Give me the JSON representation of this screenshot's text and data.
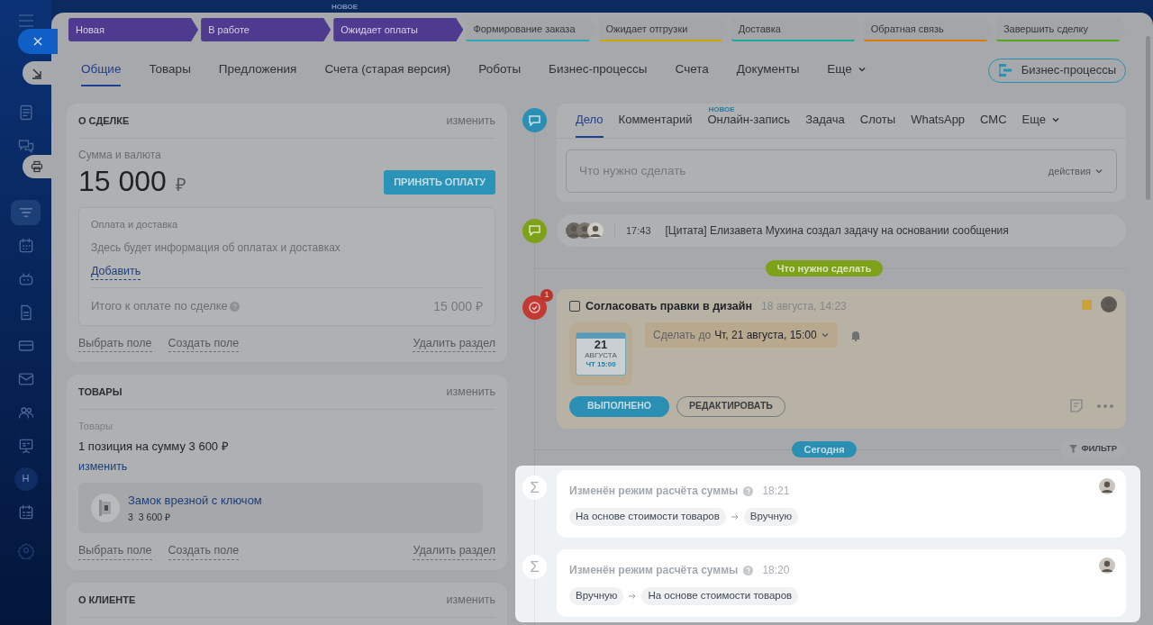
{
  "top_badge": "НОВОЕ",
  "sidebar": {
    "items": [
      {
        "kind": "icon",
        "selected": false
      },
      {
        "kind": "icon",
        "selected": false
      },
      {
        "kind": "icon",
        "selected": true
      },
      {
        "kind": "icon",
        "selected": false
      },
      {
        "kind": "icon",
        "selected": false
      },
      {
        "kind": "icon",
        "selected": false
      },
      {
        "kind": "icon",
        "selected": false
      },
      {
        "kind": "icon",
        "selected": false
      },
      {
        "kind": "icon",
        "selected": false
      },
      {
        "kind": "icon",
        "selected": false
      },
      {
        "kind": "letter",
        "text": "Н",
        "selected": false
      },
      {
        "kind": "icon",
        "selected": false
      }
    ]
  },
  "stages": [
    {
      "label": "Новая",
      "passed": true,
      "color": "#4e3a8f"
    },
    {
      "label": "В работе",
      "passed": true,
      "color": "#4e3a8f"
    },
    {
      "label": "Ожидает оплаты",
      "passed": true,
      "color": "#4e3a8f"
    },
    {
      "label": "Формирование заказа",
      "passed": false,
      "color": "#2fa6b5"
    },
    {
      "label": "Ожидает отгрузки",
      "passed": false,
      "color": "#c9a806"
    },
    {
      "label": "Доставка",
      "passed": false,
      "color": "#1aa8a0"
    },
    {
      "label": "Обратная связь",
      "passed": false,
      "color": "#d67a0a"
    },
    {
      "label": "Завершить сделку",
      "passed": false,
      "color": "#5aa51e"
    }
  ],
  "tabs": [
    {
      "label": "Общие",
      "selected": true
    },
    {
      "label": "Товары",
      "selected": false
    },
    {
      "label": "Предложения",
      "selected": false
    },
    {
      "label": "Счета (старая версия)",
      "selected": false
    },
    {
      "label": "Роботы",
      "selected": false
    },
    {
      "label": "Бизнес-процессы",
      "selected": false
    },
    {
      "label": "Счета",
      "selected": false
    },
    {
      "label": "Документы",
      "selected": false
    },
    {
      "label": "Еще",
      "selected": false,
      "dropdown": true
    }
  ],
  "process_button": "Бизнес-процессы",
  "deal_card": {
    "title": "О СДЕЛКЕ",
    "edit": "изменить",
    "amount_label": "Сумма и валюта",
    "amount": "15 000",
    "currency": "₽",
    "pay_button": "ПРИНЯТЬ ОПЛАТУ",
    "payment": {
      "title": "Оплата и доставка",
      "text": "Здесь будет информация об оплатах и доставках",
      "add_link": "Добавить",
      "total_label": "Итого к оплате по сделке",
      "total": "15 000 ₽"
    },
    "footer": {
      "choose": "Выбрать поле",
      "create": "Создать поле",
      "delete": "Удалить раздел"
    }
  },
  "products_card": {
    "title": "ТОВАРЫ",
    "edit": "изменить",
    "label": "Товары",
    "summary": "1 позиция на сумму 3 600 ₽",
    "edit_link": "изменить",
    "product": {
      "name": "Замок врезной с ключом",
      "qty": "3",
      "price": "3 600 ₽"
    },
    "footer": {
      "choose": "Выбрать поле",
      "create": "Создать поле",
      "delete": "Удалить раздел"
    }
  },
  "client_card": {
    "title": "О КЛИЕНТЕ",
    "edit": "изменить"
  },
  "composer": {
    "tabs": [
      {
        "label": "Дело",
        "selected": true
      },
      {
        "label": "Комментарий",
        "selected": false
      },
      {
        "label": "Онлайн-запись",
        "selected": false,
        "badge": "НОВОЕ"
      },
      {
        "label": "Задача",
        "selected": false
      },
      {
        "label": "Слоты",
        "selected": false
      },
      {
        "label": "WhatsApp",
        "selected": false
      },
      {
        "label": "СМС",
        "selected": false
      },
      {
        "label": "Еще",
        "selected": false,
        "dropdown": true
      }
    ],
    "placeholder": "Что нужно сделать",
    "actions": "действия"
  },
  "quote": {
    "time": "17:43",
    "text": "[Цитата] Елизавета Мухина создал задачу на основании сообщения"
  },
  "todo_divider": "Что нужно сделать",
  "task": {
    "badge": "1",
    "checked": false,
    "title": "Согласовать правки в дизайн",
    "date": "18 августа, 14:23",
    "deadline_prefix": "Сделать до",
    "deadline": "Чт, 21 августа, 15:00",
    "calendar": {
      "day": "21",
      "month": "АВГУСТА",
      "time": "ЧТ 15:00"
    },
    "done_button": "ВЫПОЛНЕНО",
    "edit_button": "РЕДАКТИРОВАТЬ"
  },
  "today_divider": "Сегодня",
  "filter": "ФИЛЬТР",
  "changes": [
    {
      "icon": "Σ",
      "title": "Изменён режим расчёта суммы",
      "time": "18:21",
      "from": "На основе стоимости товаров",
      "to": "Вручную"
    },
    {
      "icon": "Σ",
      "title": "Изменён режим расчёта суммы",
      "time": "18:20",
      "from": "Вручную",
      "to": "На основе стоимости товаров"
    }
  ]
}
